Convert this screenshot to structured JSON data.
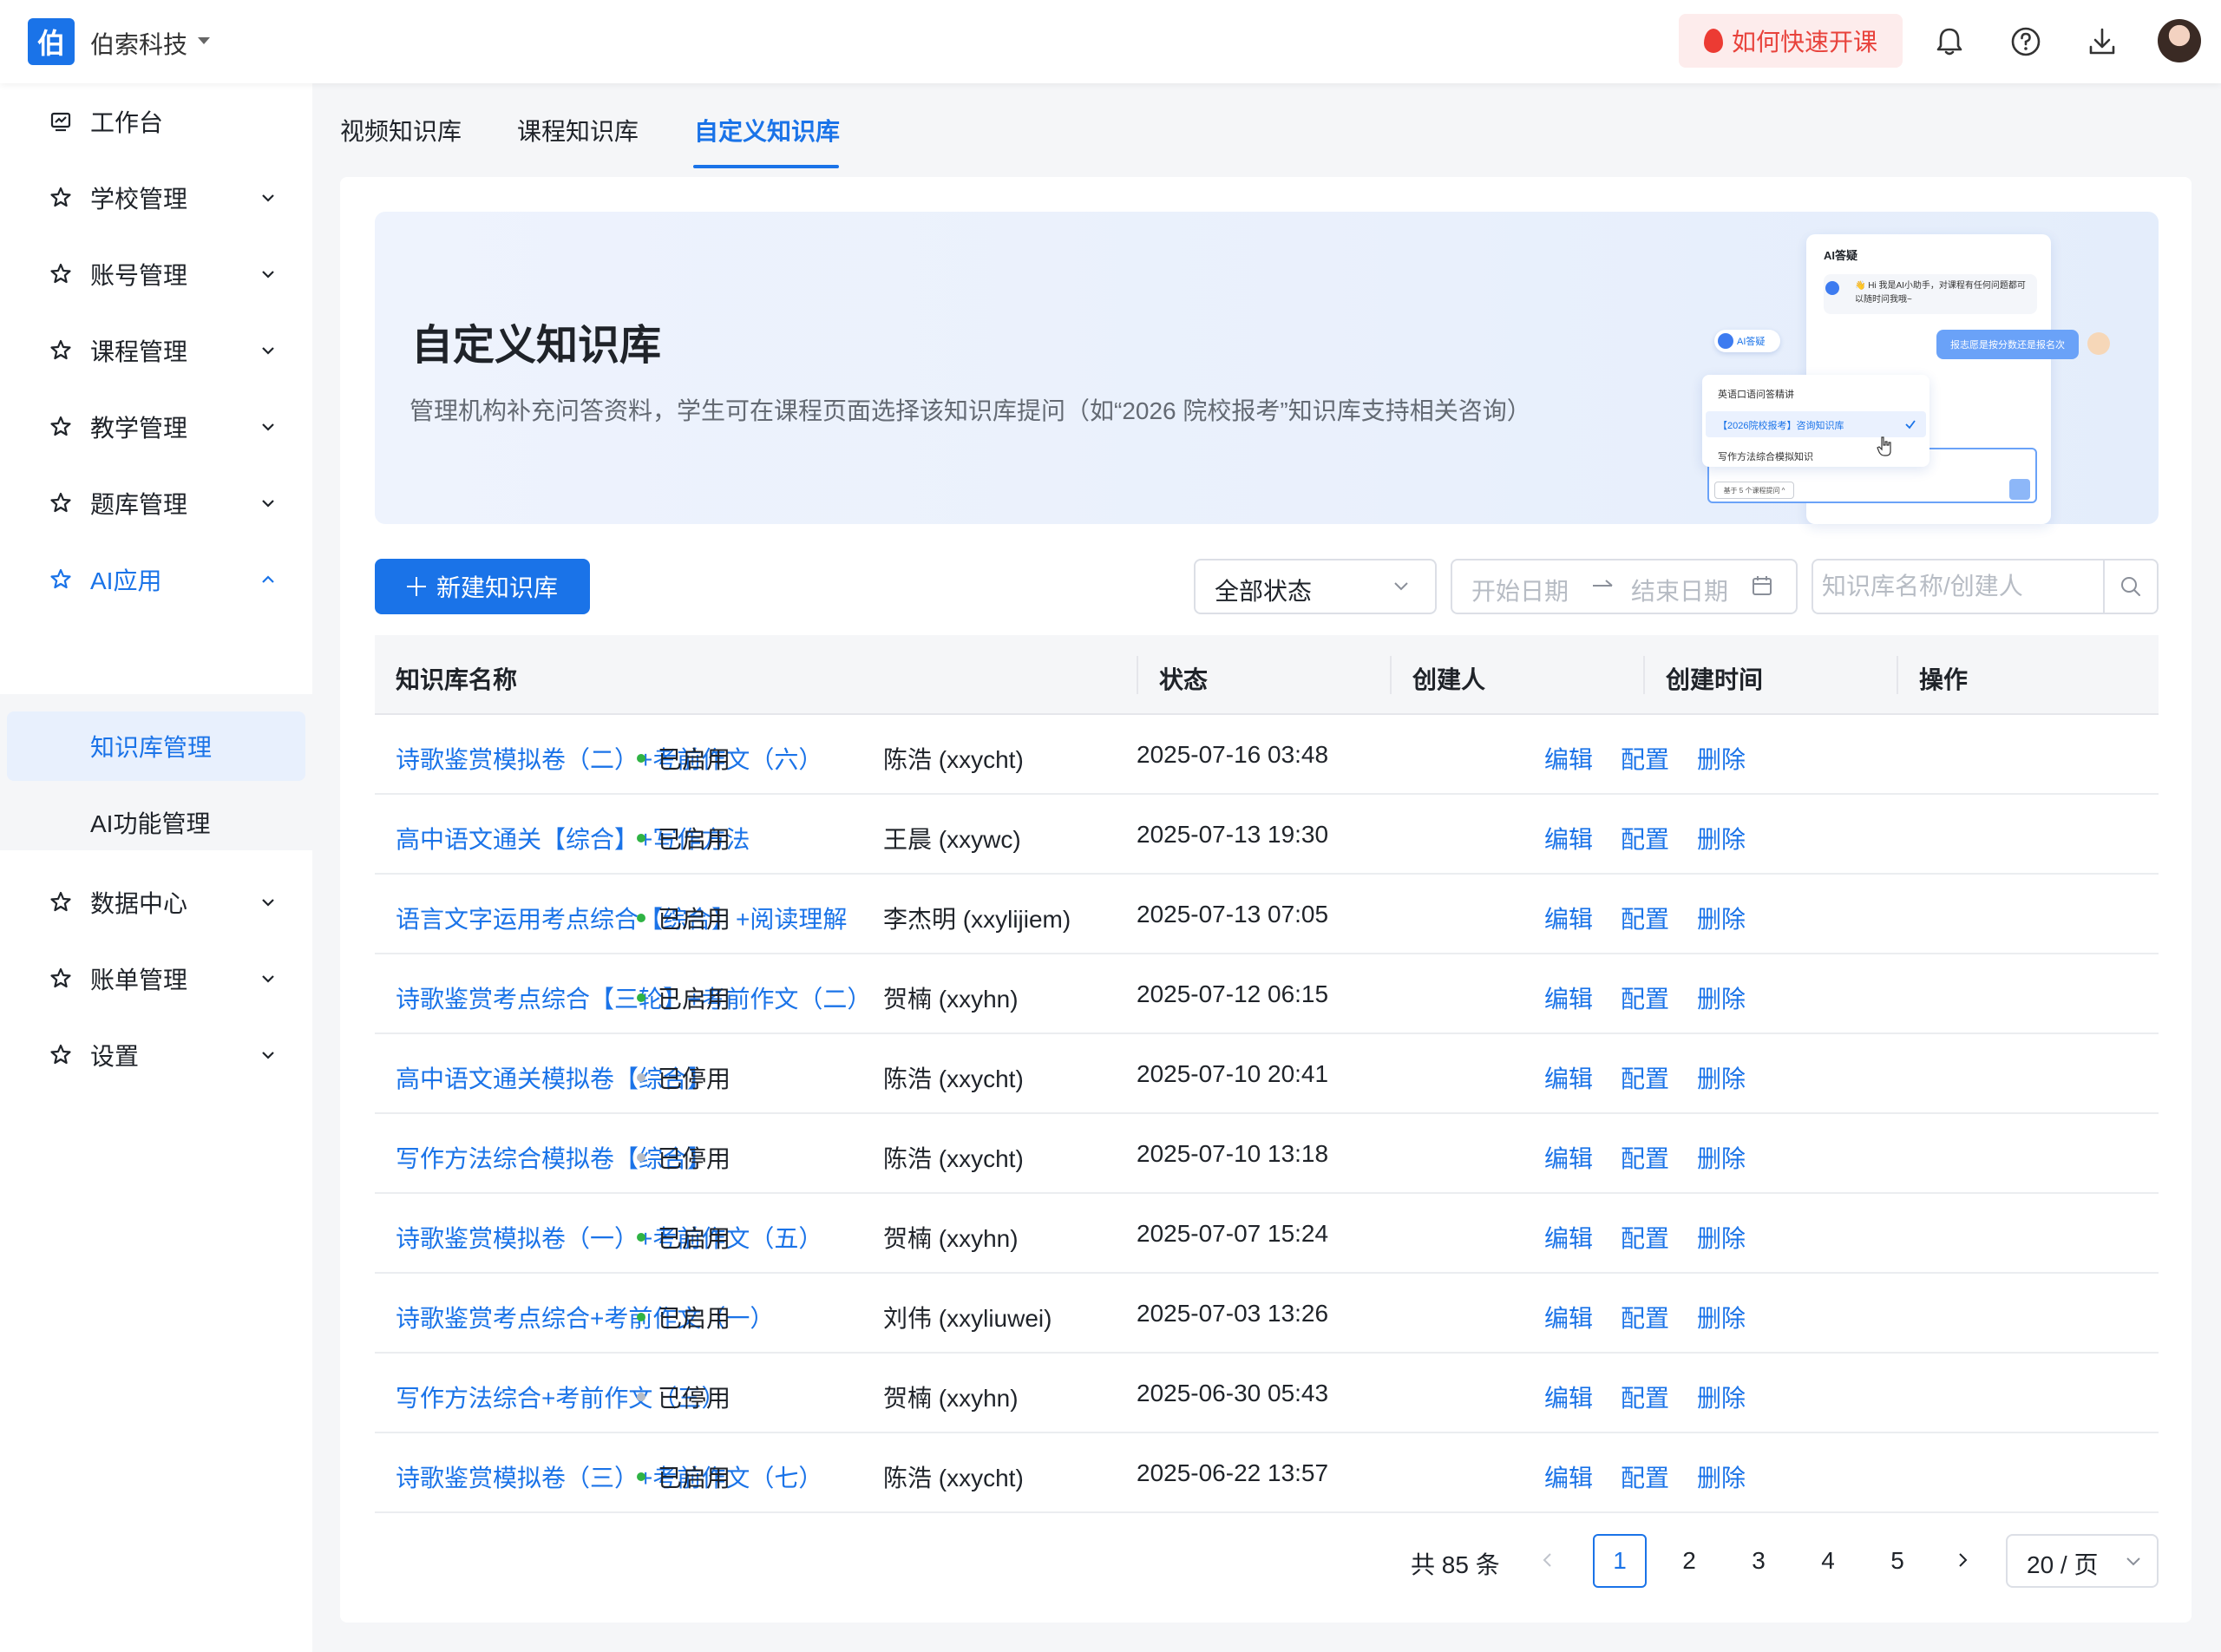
{
  "header": {
    "logo_char": "伯",
    "org_name": "伯索科技",
    "quick_start": "如何快速开课"
  },
  "sidebar": {
    "items": [
      {
        "label": "工作台",
        "icon": "dashboard-icon",
        "chevron": ""
      },
      {
        "label": "学校管理",
        "icon": "star-icon",
        "chevron": "down"
      },
      {
        "label": "账号管理",
        "icon": "star-icon",
        "chevron": "down"
      },
      {
        "label": "课程管理",
        "icon": "star-icon",
        "chevron": "down"
      },
      {
        "label": "教学管理",
        "icon": "star-icon",
        "chevron": "down"
      },
      {
        "label": "题库管理",
        "icon": "star-icon",
        "chevron": "down"
      },
      {
        "label": "AI应用",
        "icon": "star-icon",
        "chevron": "up"
      }
    ],
    "sub_items": [
      {
        "label": "知识库管理",
        "active": true
      },
      {
        "label": "AI功能管理",
        "active": false
      }
    ],
    "items_after": [
      {
        "label": "数据中心",
        "icon": "star-icon",
        "chevron": "down"
      },
      {
        "label": "账单管理",
        "icon": "star-icon",
        "chevron": "down"
      },
      {
        "label": "设置",
        "icon": "star-icon",
        "chevron": "down"
      }
    ]
  },
  "tabs": [
    "视频知识库",
    "课程知识库",
    "自定义知识库"
  ],
  "banner": {
    "title": "自定义知识库",
    "description": "管理机构补充问答资料，学生可在课程页面选择该知识库提问（如“2026 院校报考”知识库支持相关咨询）",
    "illustration": {
      "panel_title": "AI答疑",
      "bot_message": "👋 Hi 我是AI小助手，对课程有任何问题都可以随时问我哦~",
      "user_bubble": "报志愿是按分数还是报名次",
      "ai_tag": "AI答疑",
      "options": [
        "英语口语问答精讲",
        "【2026院校报考】咨询知识库",
        "写作方法综合模拟知识"
      ],
      "chip": "基于 5 个课程提问 ^"
    }
  },
  "toolbar": {
    "new_button": "新建知识库",
    "status_select": "全部状态",
    "date_start": "开始日期",
    "date_end": "结束日期",
    "search_placeholder": "知识库名称/创建人"
  },
  "table": {
    "headers": [
      "知识库名称",
      "状态",
      "创建人",
      "创建时间",
      "操作"
    ],
    "actions": [
      "编辑",
      "配置",
      "删除"
    ],
    "rows": [
      {
        "name": "诗歌鉴赏模拟卷（二）+考前作文（六）",
        "status": "已启用",
        "enabled": true,
        "creator": "陈浩 (xxycht)",
        "time": "2025-07-16 03:48"
      },
      {
        "name": "高中语文通关【综合】+写作方法",
        "status": "已启用",
        "enabled": true,
        "creator": "王晨 (xxywc)",
        "time": "2025-07-13 19:30"
      },
      {
        "name": "语言文字运用考点综合【综合】+阅读理解",
        "status": "已启用",
        "enabled": true,
        "creator": "李杰明 (xxylijiem)",
        "time": "2025-07-13 07:05"
      },
      {
        "name": "诗歌鉴赏考点综合【三轮】+考前作文（二）",
        "status": "已启用",
        "enabled": true,
        "creator": "贺楠 (xxyhn)",
        "time": "2025-07-12 06:15"
      },
      {
        "name": "高中语文通关模拟卷【综合】",
        "status": "已停用",
        "enabled": false,
        "creator": "陈浩 (xxycht)",
        "time": "2025-07-10 20:41"
      },
      {
        "name": "写作方法综合模拟卷【综合】",
        "status": "已停用",
        "enabled": false,
        "creator": "陈浩 (xxycht)",
        "time": "2025-07-10 13:18"
      },
      {
        "name": "诗歌鉴赏模拟卷（一）+考前作文（五）",
        "status": "已启用",
        "enabled": true,
        "creator": "贺楠 (xxyhn)",
        "time": "2025-07-07 15:24"
      },
      {
        "name": "诗歌鉴赏考点综合+考前作文（一）",
        "status": "已启用",
        "enabled": true,
        "creator": "刘伟 (xxyliuwei)",
        "time": "2025-07-03 13:26"
      },
      {
        "name": "写作方法综合+考前作文（三）",
        "status": "已停用",
        "enabled": false,
        "creator": "贺楠 (xxyhn)",
        "time": "2025-06-30 05:43"
      },
      {
        "name": "诗歌鉴赏模拟卷（三）+考前作文（七）",
        "status": "已启用",
        "enabled": true,
        "creator": "陈浩 (xxycht)",
        "time": "2025-06-22 13:57"
      }
    ]
  },
  "pagination": {
    "total": "共 85 条",
    "pages": [
      "1",
      "2",
      "3",
      "4",
      "5"
    ],
    "current": "1",
    "page_size": "20 / 页"
  },
  "colors": {
    "primary": "#1a73e8",
    "enabled_dot": "#2fb344",
    "disabled_dot": "#b7bcc4",
    "quick_start_bg": "#fdecec",
    "quick_start_text": "#e8423b"
  }
}
